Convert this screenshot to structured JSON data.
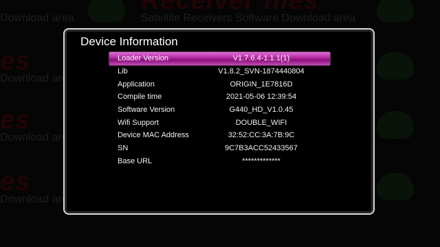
{
  "dialog": {
    "title": "Device Information",
    "rows": [
      {
        "label": "Loader Version",
        "value": "V1.7.6.4-1.1.1(1)",
        "selected": true
      },
      {
        "label": "Lib",
        "value": "V1.8.2_SVN-1874440804",
        "selected": false
      },
      {
        "label": "Application",
        "value": "ORIGIN_1E7816D",
        "selected": false
      },
      {
        "label": "Compile time",
        "value": "2021-05-06 12:39:54",
        "selected": false
      },
      {
        "label": "Software Version",
        "value": "G440_HD_V1.0.45",
        "selected": false
      },
      {
        "label": "Wifi Support",
        "value": "DOUBLE_WIFI",
        "selected": false
      },
      {
        "label": "Device MAC Address",
        "value": "32:52:CC:3A:7B:9C",
        "selected": false
      },
      {
        "label": "SN",
        "value": "9C7B3ACC52433567",
        "selected": false
      },
      {
        "label": "Base URL",
        "value": "*************",
        "selected": false
      }
    ]
  },
  "watermark": {
    "title": "Receiver files",
    "subtitle": "Satellite Receivers Software Download area",
    "fragment": "Download area",
    "fragment_title": "es"
  },
  "colors": {
    "highlight": "#b0279f",
    "panel_border": "#d7d7d7",
    "background": "#050505"
  }
}
